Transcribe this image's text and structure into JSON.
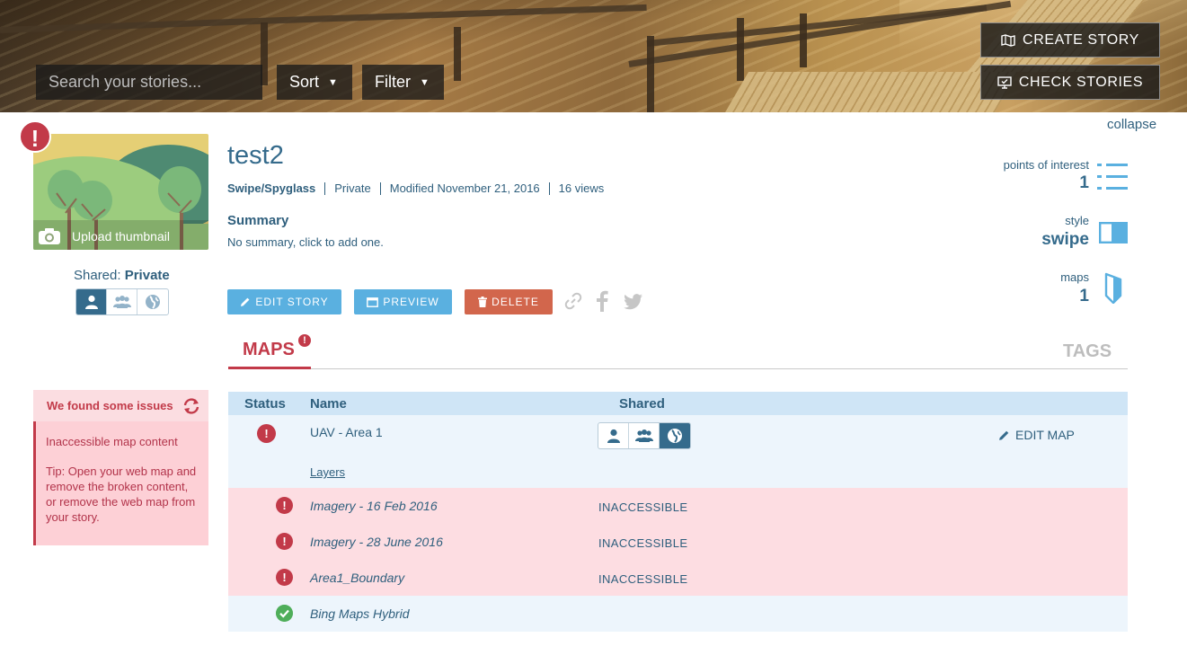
{
  "header": {
    "search_placeholder": "Search your stories...",
    "sort_label": "Sort",
    "filter_label": "Filter",
    "create_story_label": "CREATE STORY",
    "check_stories_label": "CHECK STORIES"
  },
  "collapse_label": "collapse",
  "thumbnail": {
    "upload_label": "Upload thumbnail",
    "shared_prefix": "Shared:",
    "shared_value": "Private",
    "share_options": [
      "private-icon",
      "group-icon",
      "globe-icon"
    ],
    "active_option": "private"
  },
  "issues": {
    "title": "We found some issues",
    "message": "Inaccessible map content",
    "tip": "Tip: Open your web map and remove the broken content, or remove the web map from your story."
  },
  "story": {
    "title": "test2",
    "template": "Swipe/Spyglass",
    "privacy": "Private",
    "modified": "Modified November 21, 2016",
    "views": "16 views",
    "summary_heading": "Summary",
    "summary_text": "No summary, click to add one.",
    "edit_label": "EDIT STORY",
    "preview_label": "PREVIEW",
    "delete_label": "DELETE"
  },
  "stats": {
    "poi_label": "points of interest",
    "poi_value": "1",
    "style_label": "style",
    "style_value": "swipe",
    "maps_label": "maps",
    "maps_value": "1"
  },
  "tabs": {
    "maps_label": "MAPS",
    "maps_badge": "!",
    "tags_label": "TAGS"
  },
  "table": {
    "headers": {
      "status": "Status",
      "name": "Name",
      "shared": "Shared"
    },
    "map": {
      "name": "UAV - Area 1",
      "layers_link": "Layers",
      "edit_label": "EDIT MAP",
      "active_share": "public"
    },
    "layers": [
      {
        "name": "Imagery - 16 Feb 2016",
        "state": "INACCESSIBLE",
        "status": "error"
      },
      {
        "name": "Imagery - 28 June 2016",
        "state": "INACCESSIBLE",
        "status": "error"
      },
      {
        "name": "Area1_Boundary",
        "state": "INACCESSIBLE",
        "status": "error"
      },
      {
        "name": "Bing Maps Hybrid",
        "state": "",
        "status": "ok"
      }
    ]
  },
  "colors": {
    "accent": "#356b8c",
    "error": "#c23a49",
    "ok": "#4fae5a",
    "edit_button": "#5ab0e0",
    "delete_button": "#d2664c"
  }
}
